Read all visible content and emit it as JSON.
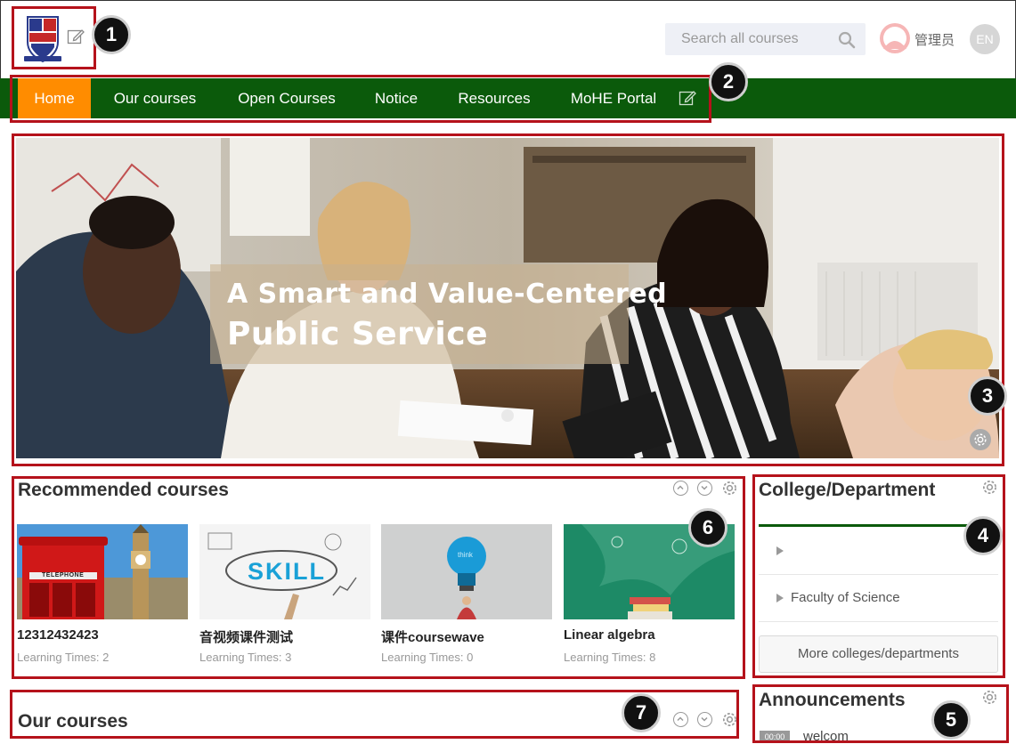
{
  "header": {
    "search_placeholder": "Search all courses",
    "username": "管理员",
    "language": "EN"
  },
  "nav": {
    "items": [
      {
        "label": "Home",
        "active": true
      },
      {
        "label": "Our courses"
      },
      {
        "label": "Open Courses"
      },
      {
        "label": "Notice"
      },
      {
        "label": "Resources"
      },
      {
        "label": "MoHE Portal"
      }
    ]
  },
  "banner": {
    "line1": "A Smart and Value-Centered",
    "line2": "Public Service"
  },
  "recommended": {
    "title": "Recommended courses",
    "courses": [
      {
        "title": "12312432423",
        "meta": "Learning Times: 2"
      },
      {
        "title": "音视频课件测试",
        "meta": "Learning Times: 3"
      },
      {
        "title": "课件coursewave",
        "meta": "Learning Times: 0"
      },
      {
        "title": "Linear algebra",
        "meta": "Learning Times: 8"
      }
    ]
  },
  "college": {
    "title": "College/Department",
    "items": [
      "",
      "Faculty of Science"
    ],
    "more_button": "More colleges/departments"
  },
  "announcements": {
    "title": "Announcements",
    "first_time": "00:00",
    "first_text": "welcom"
  },
  "our_courses": {
    "title": "Our courses"
  },
  "callouts": [
    "1",
    "2",
    "3",
    "4",
    "5",
    "6",
    "7"
  ],
  "colors": {
    "nav_bg": "#0b5a0b",
    "active_tab": "#ff8c00",
    "annotation": "#b5121b"
  },
  "thumb_labels": {
    "phone_booth": "TELEPHONE",
    "skill": "SKILL",
    "bulb": "think"
  }
}
